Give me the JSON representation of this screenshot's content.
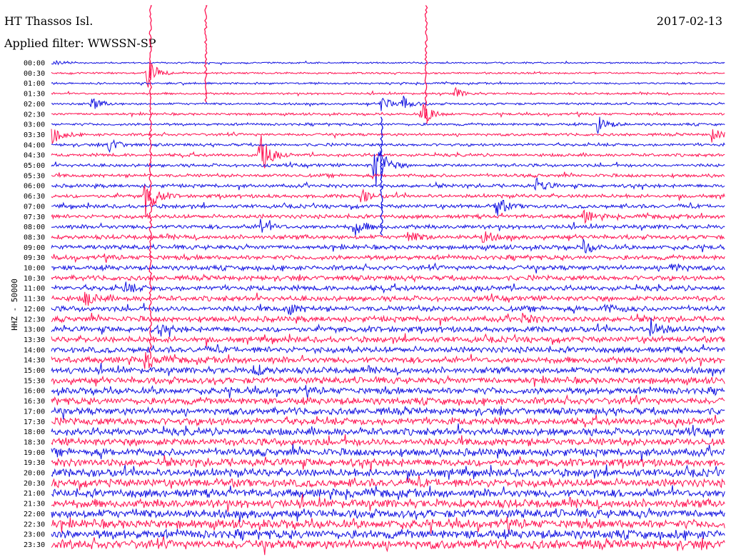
{
  "header": {
    "station": "HT Thassos Isl.",
    "filter": "Applied filter: WWSSN-SP",
    "date": "2017-02-13"
  },
  "chart_data": {
    "type": "line",
    "title": "HT Thassos Isl.",
    "subtitle": "Applied filter: WWSSN-SP",
    "date": "2017-02-13",
    "ylabel": "HHZ - 50000",
    "ytick_labels": [
      "00:00",
      "00:30",
      "01:00",
      "01:30",
      "02:00",
      "02:30",
      "03:00",
      "03:30",
      "04:00",
      "04:30",
      "05:00",
      "05:30",
      "06:00",
      "06:30",
      "07:00",
      "07:30",
      "08:00",
      "08:30",
      "09:00",
      "09:30",
      "10:00",
      "10:30",
      "11:00",
      "11:30",
      "12:00",
      "12:30",
      "13:00",
      "13:30",
      "14:00",
      "14:30",
      "15:00",
      "15:30",
      "16:00",
      "16:30",
      "17:00",
      "17:30",
      "18:00",
      "18:30",
      "19:00",
      "19:30",
      "20:00",
      "20:30",
      "21:00",
      "21:30",
      "22:00",
      "22:30",
      "23:00",
      "23:30"
    ],
    "colors": [
      "#1010e0",
      "#ff1050"
    ],
    "grid": false,
    "events": [
      {
        "trace": "00:30",
        "t": 0.143,
        "amp": 3.5
      },
      {
        "trace": "02:00",
        "t": 0.06,
        "amp": 1.5
      },
      {
        "trace": "02:00",
        "t": 0.49,
        "amp": 2.0
      },
      {
        "trace": "02:00",
        "t": 0.52,
        "amp": 1.8
      },
      {
        "trace": "02:30",
        "t": 0.55,
        "amp": 3.0
      },
      {
        "trace": "01:30",
        "t": 0.6,
        "amp": 1.2
      },
      {
        "trace": "03:00",
        "t": 0.81,
        "amp": 2.2
      },
      {
        "trace": "03:30",
        "t": 0.0,
        "amp": 2.5
      },
      {
        "trace": "03:30",
        "t": 0.98,
        "amp": 1.6
      },
      {
        "trace": "04:00",
        "t": 0.085,
        "amp": 2.0
      },
      {
        "trace": "04:30",
        "t": 0.31,
        "amp": 5.0
      },
      {
        "trace": "05:00",
        "t": 0.48,
        "amp": 7.0
      },
      {
        "trace": "06:00",
        "t": 0.72,
        "amp": 2.0
      },
      {
        "trace": "06:30",
        "t": 0.14,
        "amp": 5.0
      },
      {
        "trace": "06:30",
        "t": 0.46,
        "amp": 1.5
      },
      {
        "trace": "07:00",
        "t": 0.66,
        "amp": 2.5
      },
      {
        "trace": "07:30",
        "t": 0.79,
        "amp": 1.5
      },
      {
        "trace": "08:00",
        "t": 0.31,
        "amp": 2.0
      },
      {
        "trace": "08:00",
        "t": 0.45,
        "amp": 2.0
      },
      {
        "trace": "08:30",
        "t": 0.53,
        "amp": 1.5
      },
      {
        "trace": "08:30",
        "t": 0.64,
        "amp": 1.5
      },
      {
        "trace": "09:00",
        "t": 0.79,
        "amp": 1.6
      },
      {
        "trace": "10:00",
        "t": 0.92,
        "amp": 1.2
      },
      {
        "trace": "11:00",
        "t": 0.11,
        "amp": 1.2
      },
      {
        "trace": "11:30",
        "t": 0.05,
        "amp": 1.8
      },
      {
        "trace": "12:00",
        "t": 0.35,
        "amp": 1.4
      },
      {
        "trace": "12:00",
        "t": 0.82,
        "amp": 1.0
      },
      {
        "trace": "12:30",
        "t": 0.7,
        "amp": 1.2
      },
      {
        "trace": "13:00",
        "t": 0.89,
        "amp": 2.4
      },
      {
        "trace": "13:00",
        "t": 0.16,
        "amp": 1.0
      },
      {
        "trace": "14:30",
        "t": 0.14,
        "amp": 2.0
      },
      {
        "trace": "15:00",
        "t": 0.3,
        "amp": 1.2
      }
    ],
    "spikes": [
      {
        "trace": "05:00",
        "t": 0.147,
        "top": "00:00",
        "bottom": "14:30",
        "color_index": 1
      },
      {
        "trace": "00:30",
        "t": 0.556,
        "top": "00:00",
        "bottom": "03:00",
        "color_index": 1
      },
      {
        "trace": "01:00",
        "t": 0.229,
        "top": "00:00",
        "bottom": "02:00",
        "color_index": 1
      },
      {
        "trace": "05:00",
        "t": 0.49,
        "top": "03:30",
        "bottom": "08:30",
        "color_index": 0
      }
    ]
  }
}
